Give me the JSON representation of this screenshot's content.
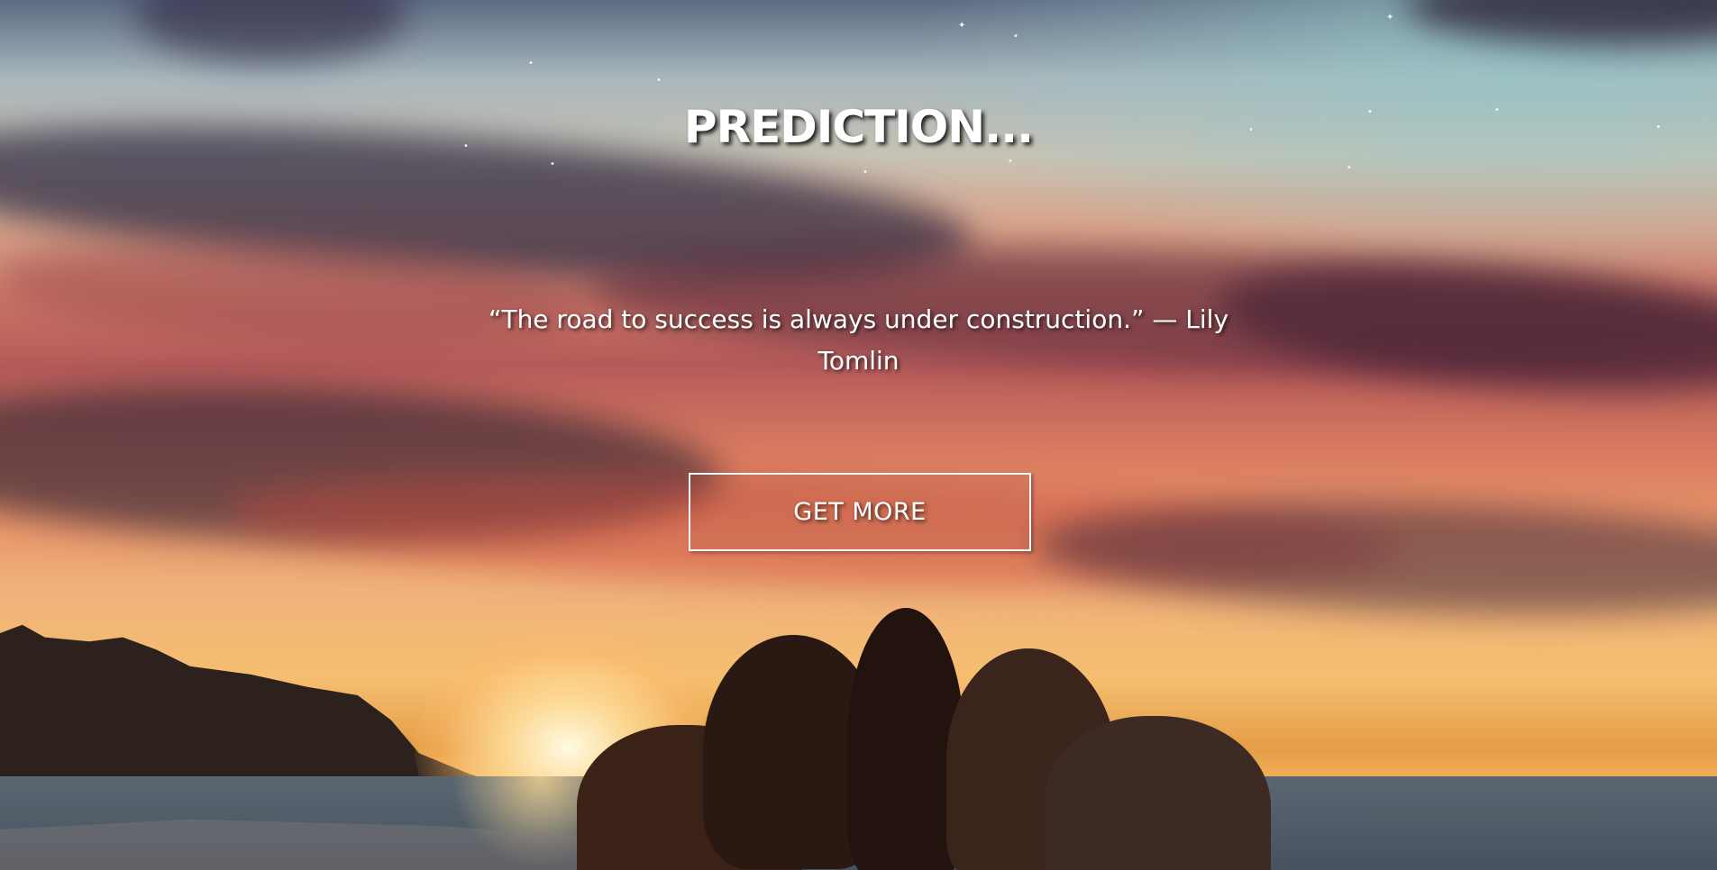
{
  "hero": {
    "title": "PREDICTION...",
    "quote": "“The road to success is always under construction.” — Lily Tomlin",
    "cta_label": "GET MORE"
  },
  "colors": {
    "text": "#ffffff",
    "button_border": "#ffffff"
  }
}
